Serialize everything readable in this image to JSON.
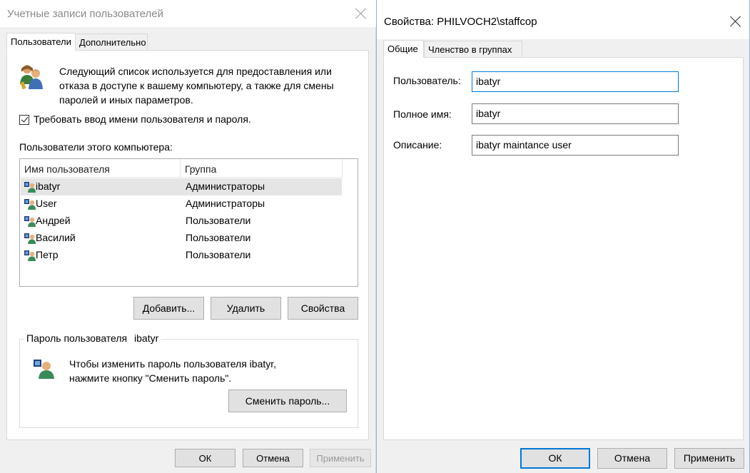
{
  "left": {
    "title": "Учетные записи пользователей",
    "tabs": [
      "Пользователи",
      "Дополнительно"
    ],
    "intro_lines": [
      "Следующий список используется для предоставления или",
      "отказа в доступе к вашему компьютеру, а также для смены",
      "паролей и иных параметров."
    ],
    "require_checkbox_label": "Требовать ввод имени пользователя и пароля.",
    "require_checked": true,
    "users_label": "Пользователи этого компьютера:",
    "columns": [
      "Имя пользователя",
      "Группа"
    ],
    "users": [
      {
        "name": "ibatyr",
        "group": "Администраторы",
        "selected": true
      },
      {
        "name": "User",
        "group": "Администраторы"
      },
      {
        "name": "Андрей",
        "group": "Пользователи"
      },
      {
        "name": "Василий",
        "group": "Пользователи"
      },
      {
        "name": "Петр",
        "group": "Пользователи"
      }
    ],
    "add_button": "Добавить...",
    "delete_button": "Удалить",
    "properties_button": "Свойства",
    "password_group_label": "Пароль пользователя",
    "password_group_user": "ibatyr",
    "password_text_line1": "Чтобы изменить пароль пользователя  ibatyr,",
    "password_text_line2": "нажмите кнопку \"Сменить пароль\".",
    "change_password_button": "Сменить пароль...",
    "ok": "ОК",
    "cancel": "Отмена",
    "apply": "Применить"
  },
  "right": {
    "title": "Свойства: PHILVOCH2\\staffcop",
    "tabs": [
      "Общие",
      "Членство в группах"
    ],
    "username_label": "Пользователь:",
    "username_value": "ibatyr",
    "fullname_label": "Полное имя:",
    "fullname_value": "ibatyr",
    "description_label": "Описание:",
    "description_value": "ibatyr maintance user",
    "ok": "ОК",
    "cancel": "Отмена",
    "apply": "Применить"
  },
  "colors": {
    "accent": "#0078d7",
    "selected_row": "#e5e5e5",
    "window_bg": "#f0f0f0"
  }
}
